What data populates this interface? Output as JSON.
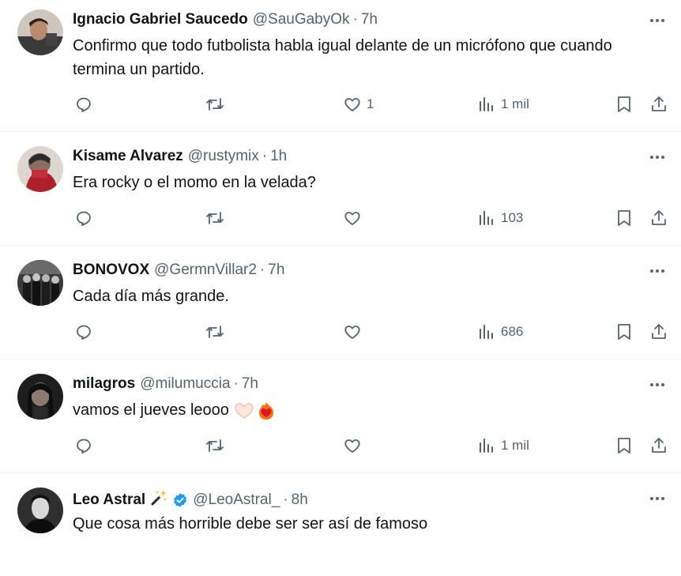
{
  "tweets": [
    {
      "name": "Ignacio Gabriel Saucedo",
      "handle": "@SauGabyOk",
      "sep": "·",
      "time": "7h",
      "text": "Confirmo que todo futbolista habla igual delante de un micrófono que cuando termina un partido.",
      "likes": "1",
      "views": "1 mil"
    },
    {
      "name": "Kisame Alvarez",
      "handle": "@rustymix",
      "sep": "·",
      "time": "1h",
      "text": "Era rocky o el momo en la velada?",
      "likes": "",
      "views": "103"
    },
    {
      "name": "BONOVOX",
      "handle": "@GermnVillar2",
      "sep": "·",
      "time": "7h",
      "text": "Cada día más grande.",
      "likes": "",
      "views": "686"
    },
    {
      "name": "milagros",
      "handle": "@milumuccia",
      "sep": "·",
      "time": "7h",
      "text": "vamos el jueves leooo",
      "likes": "",
      "views": "1 mil"
    },
    {
      "name": "Leo Astral",
      "handle": "@LeoAstral_",
      "sep": "·",
      "time": "8h",
      "text": "Que cosa más horrible debe ser ser así de famoso"
    }
  ],
  "icons": {
    "reply": "reply-icon",
    "retweet": "retweet-icon",
    "like": "heart-icon",
    "views": "views-icon",
    "bookmark": "bookmark-icon",
    "share": "share-icon",
    "more": "more-icon",
    "verified": "verified-badge-icon"
  },
  "colors": {
    "text": "#0f1419",
    "secondary": "#536471",
    "verified": "#1d9bf0",
    "divider": "#eff3f4"
  }
}
